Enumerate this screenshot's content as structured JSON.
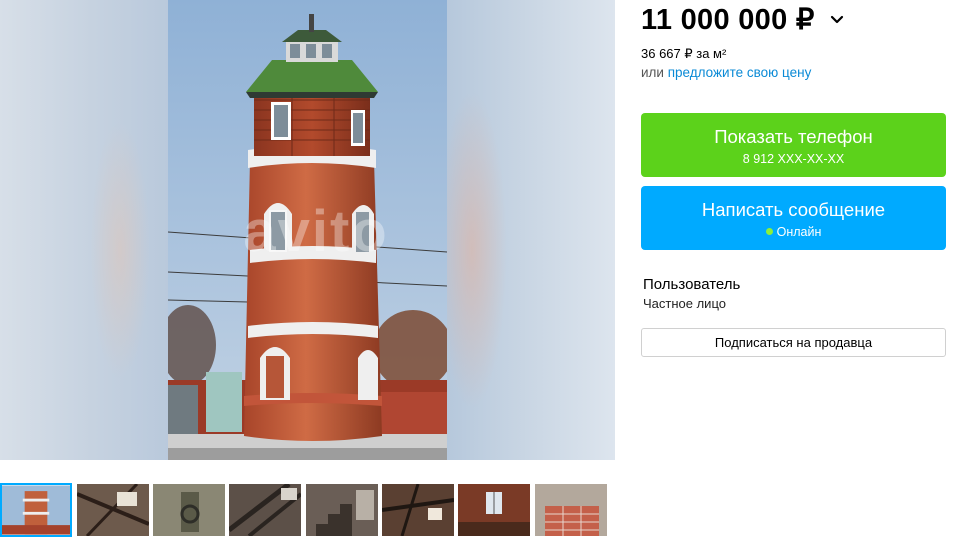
{
  "listing": {
    "price": "11 000 000 ₽",
    "price_per_meter": "36 667 ₽ за м²",
    "offer_prefix": "или ",
    "offer_link": "предложите свою цену"
  },
  "contact": {
    "phone_label": "Показать телефон",
    "phone_masked": "8 912 XXX-XX-XX",
    "message_label": "Написать сообщение",
    "online_status": "Онлайн"
  },
  "seller": {
    "name": "Пользователь",
    "type": "Частное лицо",
    "subscribe_label": "Подписаться на продавца"
  },
  "gallery": {
    "watermark": "avito",
    "thumbnails": [
      {
        "icon": "tower-exterior-photo"
      },
      {
        "icon": "tower-roof-beams-photo"
      },
      {
        "icon": "tower-interior-photo"
      },
      {
        "icon": "tower-stairs-photo"
      },
      {
        "icon": "tower-stairs-photo-2"
      },
      {
        "icon": "tower-roof-frame-photo"
      },
      {
        "icon": "tower-window-photo"
      },
      {
        "icon": "bricks-pile-photo"
      }
    ]
  },
  "colors": {
    "phone_button": "#5cd21b",
    "message_button": "#00aaff",
    "link": "#0a8ad6",
    "active_thumb_border": "#00aaff"
  }
}
